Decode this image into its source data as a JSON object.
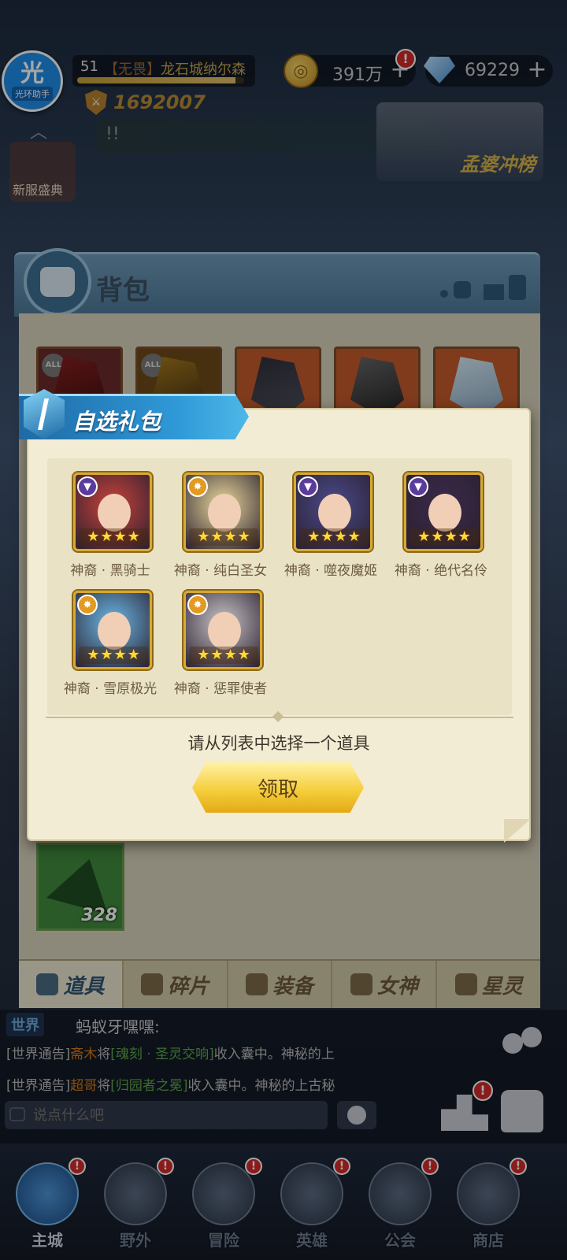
{
  "helper": {
    "big": "光",
    "small": "光环助手"
  },
  "player": {
    "level": "51",
    "guild_tag": "【无畏】",
    "name": "龙石城纳尔森",
    "exp_fraction": 0.95,
    "power": "1692007"
  },
  "currency": {
    "gold": "391万",
    "gems": "69229",
    "plus": "+",
    "alert": "!"
  },
  "news": {
    "text": "!!"
  },
  "side": {
    "new_server": "新服盛典",
    "rank_event": "孟婆冲榜"
  },
  "bag": {
    "title": "背包",
    "all_label": "ALL",
    "green_item_count": "328",
    "tabs": [
      {
        "label": "道具",
        "icon": "items-icon",
        "active": true
      },
      {
        "label": "碎片",
        "icon": "fragment-icon",
        "active": false
      },
      {
        "label": "装备",
        "icon": "equipment-icon",
        "active": false
      },
      {
        "label": "女神",
        "icon": "goddess-icon",
        "active": false
      },
      {
        "label": "星灵",
        "icon": "star-spirit-icon",
        "active": false
      }
    ]
  },
  "dialog": {
    "title": "自选礼包",
    "instruction": "请从列表中选择一个道具",
    "claim_label": "领取",
    "heroes": [
      {
        "name": "神裔 · 黑骑士",
        "type": "purple",
        "stars": 4,
        "color": "#c8423a"
      },
      {
        "name": "神裔 · 纯白圣女",
        "type": "gold",
        "stars": 4,
        "color": "#e9d89a"
      },
      {
        "name": "神裔 · 噬夜魔姬",
        "type": "purple",
        "stars": 4,
        "color": "#4a4a8a"
      },
      {
        "name": "神裔 · 绝代名伶",
        "type": "purple",
        "stars": 4,
        "color": "#3a2a4a"
      },
      {
        "name": "神裔 · 雪原极光",
        "type": "gold",
        "stars": 4,
        "color": "#6ab8e6"
      },
      {
        "name": "神裔 · 惩罪使者",
        "type": "gold",
        "stars": 4,
        "color": "#c8c4c8"
      }
    ]
  },
  "chat": {
    "channel": "世界",
    "first_line": "蚂蚁牙嘿嘿:",
    "lines": [
      {
        "prefix": "[世界通告]",
        "player": "斋木",
        "verb": "将",
        "item": "[魂刻 · 圣灵交响]",
        "suffix": "收入囊中。神秘的上"
      },
      {
        "prefix": "[世界通告]",
        "player": "超哥",
        "verb": "将",
        "item": "[归园者之冕]",
        "suffix": "收入囊中。神秘的上古秘"
      }
    ],
    "input_placeholder": "说点什么吧"
  },
  "nav": [
    {
      "label": "主城",
      "active": true,
      "alert": true
    },
    {
      "label": "野外",
      "active": false,
      "alert": true
    },
    {
      "label": "冒险",
      "active": false,
      "alert": true
    },
    {
      "label": "英雄",
      "active": false,
      "alert": true
    },
    {
      "label": "公会",
      "active": false,
      "alert": true
    },
    {
      "label": "商店",
      "active": false,
      "alert": true
    }
  ]
}
